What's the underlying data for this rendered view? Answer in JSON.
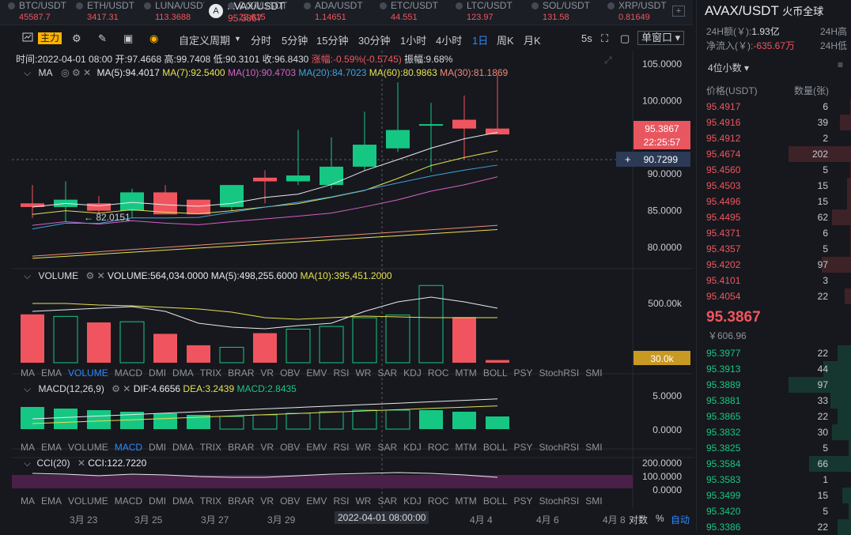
{
  "tickers": [
    {
      "name": "BTC/USDT",
      "price": "45587.7",
      "color": "#f0555f"
    },
    {
      "name": "ETH/USDT",
      "price": "3417.31",
      "color": "#f0555f"
    },
    {
      "name": "LUNA/USDT",
      "price": "113.3688",
      "color": "#f0555f"
    },
    {
      "name": "AVAX/USDT",
      "price": "95.3867",
      "color": "#f0555f",
      "icon": "A"
    },
    {
      "name": "DOT/USDT",
      "price": "22.615",
      "color": "#f0555f"
    },
    {
      "name": "ADA/USDT",
      "price": "1.14651",
      "color": "#f0555f"
    },
    {
      "name": "ETC/USDT",
      "price": "44.551",
      "color": "#f0555f"
    },
    {
      "name": "LTC/USDT",
      "price": "123.97",
      "color": "#f0555f"
    },
    {
      "name": "SOL/USDT",
      "price": "131.58",
      "color": "#f0555f"
    },
    {
      "name": "XRP/USDT",
      "price": "0.81649",
      "color": "#f0555f"
    }
  ],
  "toolbar": {
    "main_label": "主力",
    "period_menu": "自定义周期",
    "periods": [
      "分时",
      "5分钟",
      "15分钟",
      "30分钟",
      "1小时",
      "4小时",
      "1日",
      "周K",
      "月K"
    ],
    "active_period": "1日",
    "seconds": "5s",
    "window": "单窗口"
  },
  "info": {
    "time": "时间:2022-04-01 08:00",
    "open": "开:97.4668",
    "high": "高:99.7408",
    "low": "低:90.3101",
    "close": "收:96.8430",
    "change": "涨幅:-0.59%(-0.5745)",
    "amp": "振幅:9.68%"
  },
  "ma_legend": {
    "title": "MA",
    "ma5": "MA(5):94.4017",
    "ma7": "MA(7):92.5400",
    "ma10": "MA(10):90.4703",
    "ma20": "MA(20):84.7023",
    "ma60": "MA(60):80.9863",
    "ma30": "MA(30):81.1869"
  },
  "price_axis": [
    "105.0000",
    "100.0000",
    "95.0000",
    "90.0000",
    "85.0000",
    "80.0000"
  ],
  "price_tags": {
    "last": "95.3867",
    "countdown": "22:25:57",
    "cross": "90.7299",
    "min_label": "← 82.0151"
  },
  "volume_legend": {
    "title": "VOLUME",
    "vol": "VOLUME:564,034.0000",
    "ma5": "MA(5):498,255.6000",
    "ma10": "MA(10):395,451.2000"
  },
  "volume_axis": {
    "top": "500.00k",
    "tag": "30.0k"
  },
  "indicators": [
    "MA",
    "EMA",
    "VOLUME",
    "MACD",
    "DMI",
    "DMA",
    "TRIX",
    "BRAR",
    "VR",
    "OBV",
    "EMV",
    "RSI",
    "WR",
    "SAR",
    "KDJ",
    "ROC",
    "MTM",
    "BOLL",
    "PSY",
    "StochRSI",
    "SMI"
  ],
  "macd_legend": {
    "title": "MACD(12,26,9)",
    "dif": "DIF:4.6656",
    "dea": "DEA:3.2439",
    "macd": "MACD:2.8435"
  },
  "macd_axis": [
    "5.0000",
    "0.0000"
  ],
  "cci_legend": {
    "title": "CCI(20)",
    "cci": "CCI:122.7220"
  },
  "cci_axis": [
    "200.0000",
    "100.0000",
    "0.0000"
  ],
  "dates": [
    "3月 23",
    "3月 25",
    "3月 27",
    "3月 29",
    "2022-04-01 08:00:00",
    "4月 4",
    "4月 6",
    "4月 8"
  ],
  "bottom_controls": {
    "log": "对数",
    "pct": "%",
    "auto": "自动"
  },
  "chart_data": {
    "type": "candlestick",
    "categories": [
      "3/20",
      "3/21",
      "3/22",
      "3/23",
      "3/24",
      "3/25",
      "3/26",
      "3/27",
      "3/28",
      "3/29",
      "3/30",
      "3/31",
      "4/01",
      "4/02",
      "4/03"
    ],
    "open": [
      86.0,
      85.5,
      86.0,
      85.0,
      87.5,
      86.5,
      85.5,
      89.5,
      89.0,
      88.5,
      91.0,
      93.5,
      96.8,
      97.4,
      96.2
    ],
    "high": [
      88.5,
      89.0,
      87.0,
      88.0,
      88.5,
      86.5,
      86.0,
      90.5,
      96.0,
      95.0,
      98.5,
      102.5,
      99.7,
      100.7,
      103.5
    ],
    "low": [
      84.0,
      83.5,
      84.5,
      84.0,
      84.5,
      85.0,
      85.0,
      86.0,
      88.5,
      88.0,
      90.5,
      93.0,
      90.3,
      92.0,
      95.5
    ],
    "close": [
      85.5,
      86.5,
      85.0,
      87.5,
      84.5,
      84.5,
      88.5,
      89.0,
      89.8,
      91.0,
      94.0,
      96.0,
      96.8,
      96.2,
      95.4
    ],
    "volume": [
      720,
      690,
      600,
      610,
      430,
      260,
      230,
      440,
      500,
      540,
      670,
      710,
      1150,
      680,
      40
    ],
    "ma_legend_series": [
      "MA(5)",
      "MA(7)",
      "MA(10)",
      "MA(20)",
      "MA(60)",
      "MA(30)"
    ],
    "ylim": [
      78,
      106
    ]
  },
  "orderbook": {
    "title": "AVAX/USDT",
    "subtitle": "火币全球",
    "vol24_label": "24H额(￥):",
    "vol24": "1.93亿",
    "hi24": "24H高",
    "inflow_label": "净流入(￥):",
    "inflow": "-635.67万",
    "lo24": "24H低",
    "precision": "4位小数",
    "col_price": "价格(USDT)",
    "col_qty": "数量(张)",
    "asks": [
      [
        "95.4917",
        "6"
      ],
      [
        "95.4916",
        "39"
      ],
      [
        "95.4912",
        "2"
      ],
      [
        "95.4674",
        "202"
      ],
      [
        "95.4560",
        "5"
      ],
      [
        "95.4503",
        "15"
      ],
      [
        "95.4496",
        "15"
      ],
      [
        "95.4495",
        "62"
      ],
      [
        "95.4371",
        "6"
      ],
      [
        "95.4357",
        "5"
      ],
      [
        "95.4202",
        "97"
      ],
      [
        "95.4101",
        "3"
      ],
      [
        "95.4054",
        "22"
      ]
    ],
    "last": "95.3867",
    "last_cny": "￥606.96",
    "bids": [
      [
        "95.3977",
        "22"
      ],
      [
        "95.3913",
        "44"
      ],
      [
        "95.3889",
        "97"
      ],
      [
        "95.3881",
        "33"
      ],
      [
        "95.3865",
        "22"
      ],
      [
        "95.3832",
        "30"
      ],
      [
        "95.3825",
        "5"
      ],
      [
        "95.3584",
        "66"
      ],
      [
        "95.3583",
        "1"
      ],
      [
        "95.3499",
        "15"
      ],
      [
        "95.3420",
        "5"
      ],
      [
        "95.3386",
        "22"
      ]
    ]
  }
}
